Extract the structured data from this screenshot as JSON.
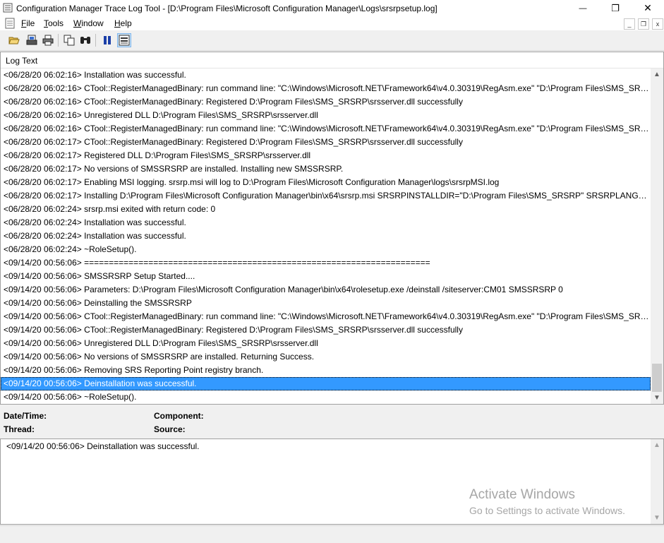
{
  "window": {
    "title": "Configuration Manager Trace Log Tool - [D:\\Program Files\\Microsoft Configuration Manager\\Logs\\srsrpsetup.log]",
    "controls": {
      "minimize": "—",
      "maximize": "❐",
      "close": "✕"
    }
  },
  "menu": {
    "items": [
      {
        "label": "File",
        "accel": "F",
        "rest": "ile"
      },
      {
        "label": "Tools",
        "accel": "T",
        "rest": "ools"
      },
      {
        "label": "Window",
        "accel": "W",
        "rest": "indow"
      },
      {
        "label": "Help",
        "accel": "H",
        "rest": "elp"
      }
    ],
    "mdi_controls": {
      "minimize": "_",
      "restore": "❐",
      "close": "x"
    }
  },
  "toolbar": {
    "buttons": [
      "open-icon",
      "print-setup-icon",
      "print-icon",
      "copy-icon",
      "find-icon",
      "pause-icon",
      "highlight-icon"
    ]
  },
  "log": {
    "column_header": "Log Text",
    "lines": [
      "<06/28/20 06:02:16> Installation was successful.",
      "<06/28/20 06:02:16> CTool::RegisterManagedBinary: run command line: \"C:\\Windows\\Microsoft.NET\\Framework64\\v4.0.30319\\RegAsm.exe\" \"D:\\Program Files\\SMS_SRSRP...",
      "<06/28/20 06:02:16> CTool::RegisterManagedBinary: Registered D:\\Program Files\\SMS_SRSRP\\srsserver.dll successfully",
      "<06/28/20 06:02:16> Unregistered DLL D:\\Program Files\\SMS_SRSRP\\srsserver.dll",
      "<06/28/20 06:02:16> CTool::RegisterManagedBinary: run command line: \"C:\\Windows\\Microsoft.NET\\Framework64\\v4.0.30319\\RegAsm.exe\" \"D:\\Program Files\\SMS_SRSRP...",
      "<06/28/20 06:02:17> CTool::RegisterManagedBinary: Registered D:\\Program Files\\SMS_SRSRP\\srsserver.dll successfully",
      "<06/28/20 06:02:17> Registered DLL D:\\Program Files\\SMS_SRSRP\\srsserver.dll",
      "<06/28/20 06:02:17> No versions of SMSSRSRP are installed.  Installing new SMSSRSRP.",
      "<06/28/20 06:02:17> Enabling MSI logging.  srsrp.msi will log to D:\\Program Files\\Microsoft Configuration Manager\\logs\\srsrpMSI.log",
      "<06/28/20 06:02:17> Installing D:\\Program Files\\Microsoft Configuration Manager\\bin\\x64\\srsrp.msi SRSRPINSTALLDIR=\"D:\\Program Files\\SMS_SRSRP\" SRSRPLANGPACKF...",
      "<06/28/20 06:02:24> srsrp.msi exited with return code: 0",
      "<06/28/20 06:02:24> Installation was successful.",
      "<06/28/20 06:02:24> Installation was successful.",
      "<06/28/20 06:02:24> ~RoleSetup().",
      "<09/14/20 00:56:06> ======================================================================",
      "<09/14/20 00:56:06> SMSSRSRP Setup Started....",
      "<09/14/20 00:56:06> Parameters: D:\\Program Files\\Microsoft Configuration Manager\\bin\\x64\\rolesetup.exe /deinstall /siteserver:CM01 SMSSRSRP 0",
      "<09/14/20 00:56:06> Deinstalling the SMSSRSRP",
      "<09/14/20 00:56:06> CTool::RegisterManagedBinary: run command line: \"C:\\Windows\\Microsoft.NET\\Framework64\\v4.0.30319\\RegAsm.exe\" \"D:\\Program Files\\SMS_SRSRP...",
      "<09/14/20 00:56:06> CTool::RegisterManagedBinary: Registered D:\\Program Files\\SMS_SRSRP\\srsserver.dll successfully",
      "<09/14/20 00:56:06> Unregistered DLL D:\\Program Files\\SMS_SRSRP\\srsserver.dll",
      "<09/14/20 00:56:06> No versions of SMSSRSRP are installed.  Returning Success.",
      "<09/14/20 00:56:06> Removing SRS Reporting Point registry branch.",
      "<09/14/20 00:56:06> Deinstallation was successful.",
      "<09/14/20 00:56:06> ~RoleSetup()."
    ],
    "selected_index": 23
  },
  "details": {
    "datetime_label": "Date/Time:",
    "component_label": "Component:",
    "thread_label": "Thread:",
    "source_label": "Source:"
  },
  "message": {
    "text": "<09/14/20 00:56:06> Deinstallation was successful."
  },
  "watermark": {
    "title": "Activate Windows",
    "subtitle": "Go to Settings to activate Windows."
  },
  "colors": {
    "selection": "#3399ff",
    "window_bg": "#f0f0f0"
  }
}
